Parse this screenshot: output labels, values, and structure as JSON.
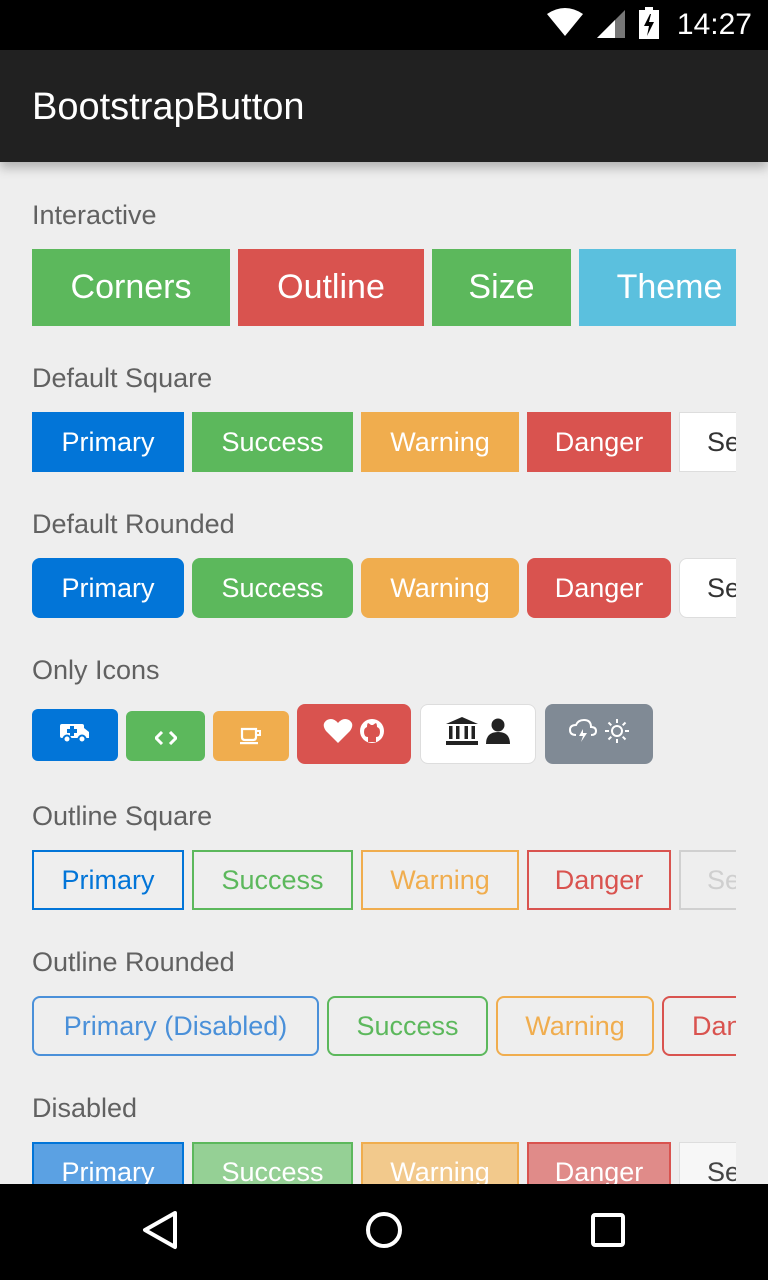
{
  "status_bar": {
    "time": "14:27",
    "icons": [
      "wifi-icon",
      "signal-icon",
      "battery-charging-icon"
    ]
  },
  "app_bar": {
    "title": "BootstrapButton"
  },
  "colors": {
    "primary": "#0275d8",
    "success": "#5cb85c",
    "warning": "#f0ad4e",
    "danger": "#d9534f",
    "info": "#5bc0de",
    "secondary": "#ffffff",
    "regular": "#808a95",
    "background": "#eeeeee",
    "appbar": "#212121",
    "label": "#616161"
  },
  "sections": {
    "interactive": {
      "label": "Interactive",
      "buttons": {
        "corners": "Corners",
        "outline": "Outline",
        "size": "Size",
        "theme": "Theme"
      }
    },
    "default_square": {
      "label": "Default Square",
      "buttons": {
        "primary": "Primary",
        "success": "Success",
        "warning": "Warning",
        "danger": "Danger",
        "secondary": "Se"
      }
    },
    "default_rounded": {
      "label": "Default Rounded",
      "buttons": {
        "primary": "Primary",
        "success": "Success",
        "warning": "Warning",
        "danger": "Danger",
        "secondary": "Se"
      }
    },
    "only_icons": {
      "label": "Only Icons",
      "icons": [
        "ambulance-icon",
        "code-icon",
        "coffee-icon",
        "heart-icon",
        "github-icon",
        "bank-icon",
        "user-icon",
        "cloud-icon",
        "sun-icon"
      ]
    },
    "outline_square": {
      "label": "Outline Square",
      "buttons": {
        "primary": "Primary",
        "success": "Success",
        "warning": "Warning",
        "danger": "Danger",
        "secondary": "Se"
      }
    },
    "outline_rounded": {
      "label": "Outline Rounded",
      "buttons": {
        "primary": "Primary (Disabled)",
        "success": "Success",
        "warning": "Warning",
        "danger": "Dan"
      }
    },
    "disabled": {
      "label": "Disabled",
      "buttons": {
        "primary": "Primary",
        "success": "Success",
        "warning": "Warning",
        "danger": "Danger",
        "secondary": "Se"
      }
    }
  },
  "nav_bar": {
    "icons": [
      "back-icon",
      "home-icon",
      "recents-icon"
    ]
  }
}
